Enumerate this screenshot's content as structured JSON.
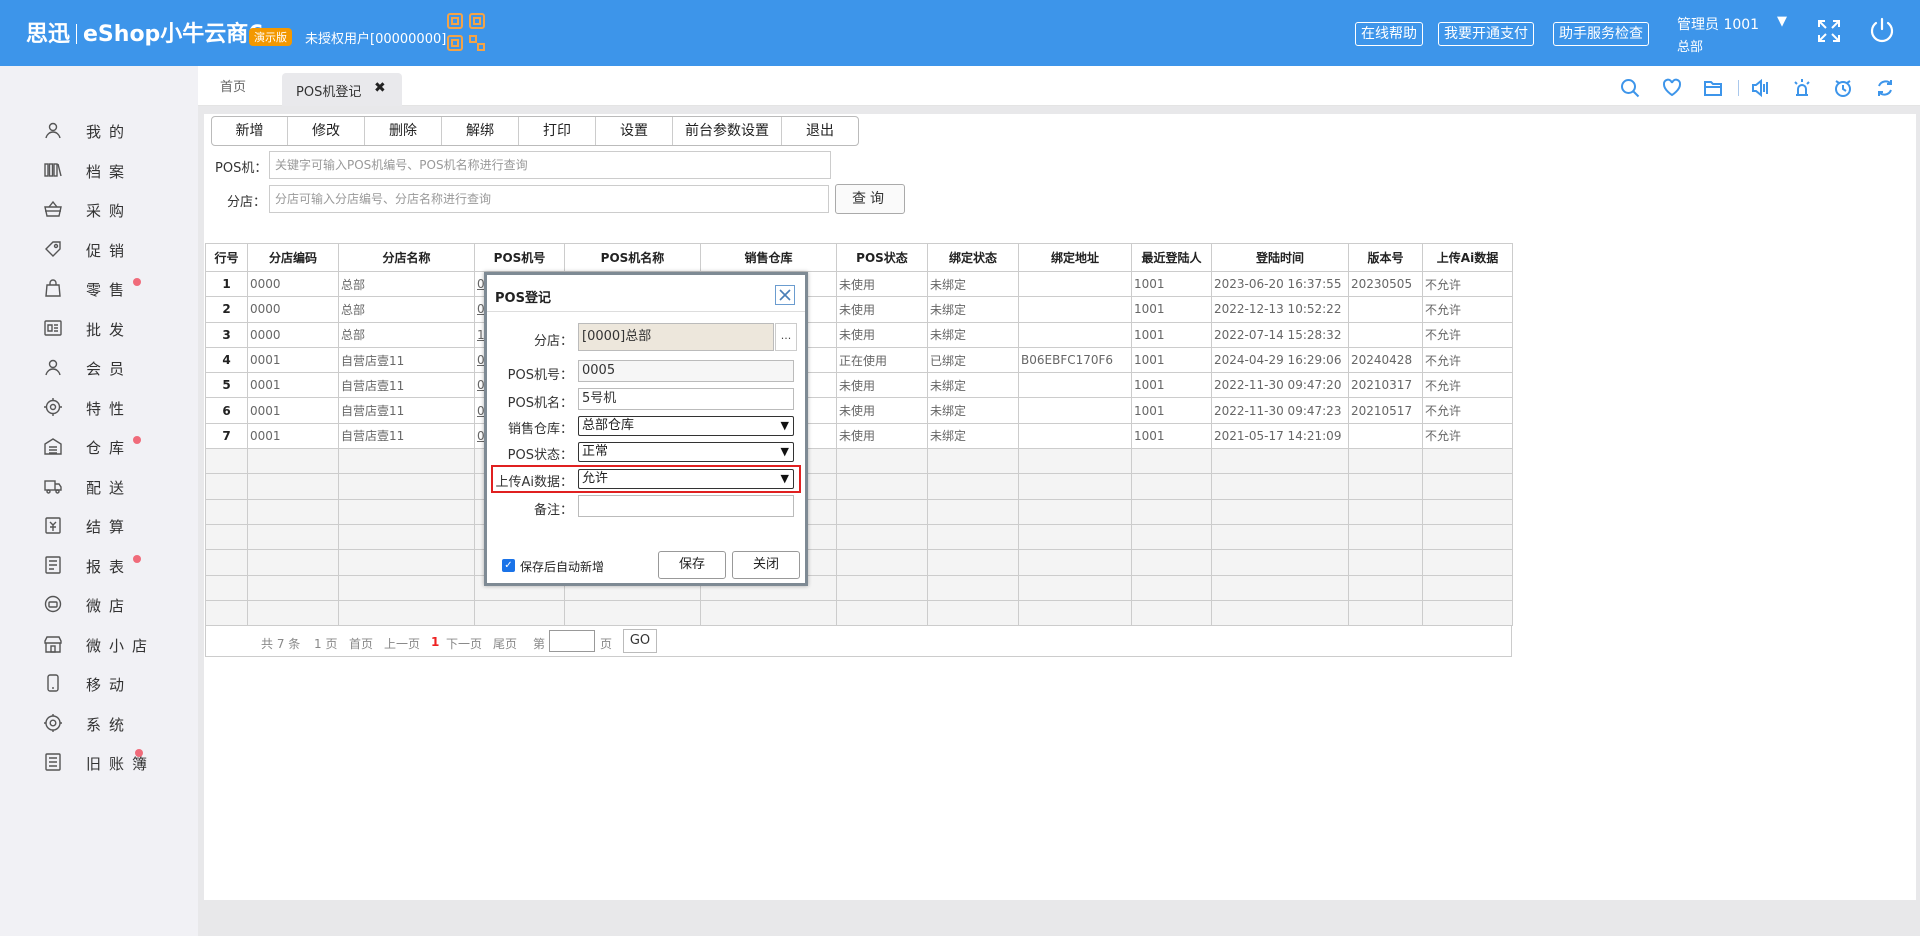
{
  "header": {
    "brand": "思迅",
    "product": "eShop小牛云商6",
    "badge": "演示版",
    "unauth_user": "未授权用户[00000000]",
    "links": [
      "在线帮助",
      "我要开通支付",
      "助手服务检查"
    ],
    "user_name": "管理员 1001",
    "user_dept": "总部",
    "caret": "▼"
  },
  "sidebar": {
    "items": [
      {
        "label": "我的",
        "icon": "user-icon",
        "dot": false
      },
      {
        "label": "档案",
        "icon": "books-icon",
        "dot": false
      },
      {
        "label": "采购",
        "icon": "basket-icon",
        "dot": false
      },
      {
        "label": "促销",
        "icon": "tag-icon",
        "dot": false
      },
      {
        "label": "零售",
        "icon": "shopping-bag-icon",
        "dot": true
      },
      {
        "label": "批发",
        "icon": "wholesale-icon",
        "dot": false
      },
      {
        "label": "会员",
        "icon": "member-icon",
        "dot": false
      },
      {
        "label": "特性",
        "icon": "target-icon",
        "dot": false
      },
      {
        "label": "仓库",
        "icon": "warehouse-icon",
        "dot": true
      },
      {
        "label": "配送",
        "icon": "truck-icon",
        "dot": false
      },
      {
        "label": "结算",
        "icon": "settlement-icon",
        "dot": false
      },
      {
        "label": "报表",
        "icon": "report-icon",
        "dot": true
      },
      {
        "label": "微店",
        "icon": "micro-shop-icon",
        "dot": false
      },
      {
        "label": "微小店",
        "icon": "mini-store-icon",
        "dot": false
      },
      {
        "label": "移动",
        "icon": "mobile-icon",
        "dot": false
      },
      {
        "label": "系统",
        "icon": "gear-icon",
        "dot": false
      },
      {
        "label": "旧账簿",
        "icon": "ledger-icon",
        "dot": true
      }
    ]
  },
  "tabs": {
    "home": "首页",
    "active": "POS机登记",
    "close": "✖"
  },
  "toolbar": {
    "buttons": [
      "新增",
      "修改",
      "删除",
      "解绑",
      "打印",
      "设置",
      "前台参数设置",
      "退出"
    ]
  },
  "filters": {
    "pos_label": "POS机：",
    "pos_placeholder": "关键字可输入POS机编号、POS机名称进行查询",
    "shop_label": "分店：",
    "shop_placeholder": "分店可输入分店编号、分店名称进行查询",
    "query": "查询"
  },
  "grid": {
    "columns": [
      "行号",
      "分店编码",
      "分店名称",
      "POS机号",
      "POS机名称",
      "销售仓库",
      "POS状态",
      "绑定状态",
      "绑定地址",
      "最近登陆人",
      "登陆时间",
      "版本号",
      "上传Ai数据"
    ],
    "rows": [
      [
        "1",
        "0000",
        "总部",
        "0",
        "",
        "",
        "未使用",
        "未绑定",
        "",
        "1001",
        "2023-06-20 16:37:55",
        "20230505",
        "不允许"
      ],
      [
        "2",
        "0000",
        "总部",
        "0",
        "",
        "",
        "未使用",
        "未绑定",
        "",
        "1001",
        "2022-12-13 10:52:22",
        "",
        "不允许"
      ],
      [
        "3",
        "0000",
        "总部",
        "1",
        "",
        "",
        "未使用",
        "未绑定",
        "",
        "1001",
        "2022-07-14 15:28:32",
        "",
        "不允许"
      ],
      [
        "4",
        "0001",
        "自营店壹11",
        "0",
        "",
        "",
        "正在使用",
        "已绑定",
        "B06EBFC170F6",
        "1001",
        "2024-04-29 16:29:06",
        "20240428",
        "不允许"
      ],
      [
        "5",
        "0001",
        "自营店壹11",
        "0",
        "",
        "",
        "未使用",
        "未绑定",
        "",
        "1001",
        "2022-11-30 09:47:20",
        "20210317",
        "不允许"
      ],
      [
        "6",
        "0001",
        "自营店壹11",
        "0",
        "",
        "",
        "未使用",
        "未绑定",
        "",
        "1001",
        "2022-11-30 09:47:23",
        "20210517",
        "不允许"
      ],
      [
        "7",
        "0001",
        "自营店壹11",
        "0",
        "",
        "",
        "未使用",
        "未绑定",
        "",
        "1001",
        "2021-05-17 14:21:09",
        "",
        "不允许"
      ]
    ],
    "empty_rows": 7
  },
  "pager": {
    "total": "共 7 条",
    "pages": "1 页",
    "first": "首页",
    "prev": "上一页",
    "current": "1",
    "next": "下一页",
    "last": "尾页",
    "goto_prefix": "第",
    "goto_suffix": "页",
    "go": "GO"
  },
  "dialog": {
    "title": "POS登记",
    "shop_label": "分店：",
    "shop_value": "[0000]总部",
    "shop_btn": "...",
    "pos_no_label": "POS机号：",
    "pos_no_value": "0005",
    "pos_name_label": "POS机名：",
    "pos_name_value": "5号机",
    "warehouse_label": "销售仓库：",
    "warehouse_value": "总部仓库",
    "status_label": "POS状态：",
    "status_value": "正常",
    "ai_label": "上传Ai数据：",
    "ai_value": "允许",
    "remark_label": "备注：",
    "remark_value": "",
    "auto_new_label": "保存后自动新增",
    "save": "保存",
    "close": "关闭"
  },
  "colors": {
    "header_bg": "#3d95ea",
    "badge_bg": "#f39800",
    "nav_dot": "#f06b7a",
    "highlight": "#e02020",
    "pager_current": "#e22222"
  }
}
